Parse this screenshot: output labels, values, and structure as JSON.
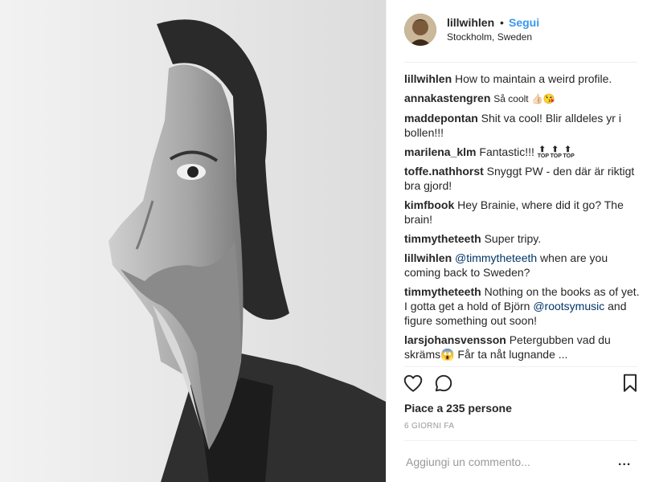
{
  "post": {
    "author": "lillwihlen",
    "separator": "•",
    "follow_label": "Segui",
    "location": "Stockholm, Sweden",
    "photo_icon": "profile-photo",
    "avatar_icon": "avatar-image"
  },
  "comments": [
    {
      "user": "lillwihlen",
      "text": "How to maintain a weird profile."
    },
    {
      "user": "annakastengren",
      "text": "Så coolt 👍🏻😘"
    },
    {
      "user": "maddepontan",
      "text": "Shit va cool! Blir alldeles yr i bollen!!!"
    },
    {
      "user": "marilena_klm",
      "text": "Fantastic!!! ",
      "tags": [
        "TOP",
        "TOP",
        "TOP"
      ]
    },
    {
      "user": "toffe.nathhorst",
      "text": "Snyggt PW - den där är riktigt bra gjord!"
    },
    {
      "user": "kimfbook",
      "text": "Hey Brainie, where did it go? The brain!"
    },
    {
      "user": "timmytheteeth",
      "text": "Super tripy."
    },
    {
      "user": "lillwihlen",
      "mention": "@timmytheteeth",
      "text": " when are you coming back to Sweden?"
    },
    {
      "user": "timmytheteeth",
      "text": "Nothing on the books as of yet. I gotta get a hold of Björn ",
      "mention2": "@rootsymusic",
      "text2": " and figure something out soon!"
    },
    {
      "user": "larsjohansvensson",
      "text": "Petergubben vad du skräms😱 Får ta nåt lugnande ..."
    }
  ],
  "actions": {
    "like_icon": "heart-icon",
    "comment_icon": "comment-icon",
    "save_icon": "bookmark-icon"
  },
  "likes": {
    "prefix": "Piace a ",
    "count": "235",
    "suffix": " persone"
  },
  "timestamp": "6 GIORNI FA",
  "add_comment": {
    "placeholder": "Aggiungi un commento...",
    "more_label": "..."
  },
  "colors": {
    "accent": "#3897f0",
    "text": "#262626",
    "muted": "#999999",
    "border": "#efefef"
  }
}
